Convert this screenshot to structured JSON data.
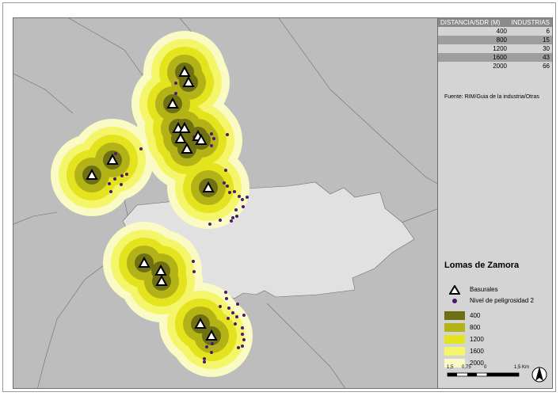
{
  "table": {
    "header_left": "DISTANCIA/SDR (M)",
    "header_right": "INDUSTRIAS",
    "rows": [
      {
        "distance": "400",
        "industries": "6",
        "shade": "#d4d4d4"
      },
      {
        "distance": "800",
        "industries": "15",
        "shade": "#9e9e9e"
      },
      {
        "distance": "1200",
        "industries": "30",
        "shade": "#d4d4d4"
      },
      {
        "distance": "1600",
        "industries": "43",
        "shade": "#9e9e9e"
      },
      {
        "distance": "2000",
        "industries": "66",
        "shade": "#d4d4d4"
      }
    ]
  },
  "source_note": "Fuente: RIM/Guia de la industria/Otras",
  "legend": {
    "title": "Lomas de Zamora",
    "basurales_label": "Basurales",
    "industry_label": "Nivel de peligrosidad 2",
    "buffers": [
      {
        "label": "400",
        "color": "#6f6f14"
      },
      {
        "label": "800",
        "color": "#b3b317"
      },
      {
        "label": "1200",
        "color": "#e3e31e"
      },
      {
        "label": "1600",
        "color": "#f5f56a"
      },
      {
        "label": "2000",
        "color": "#fafac4"
      }
    ]
  },
  "scale": {
    "labels": [
      "1,5",
      "0,75",
      "0",
      "1,5 Km"
    ]
  },
  "colors": {
    "background_land": "#bdbdbd",
    "municipality": "#e1e1e1",
    "industry_point": "#4b1872",
    "boundary": "#6e6e6e"
  },
  "map": {
    "sites": [
      [
        228,
        86
      ],
      [
        233,
        99
      ],
      [
        213,
        126
      ],
      [
        220,
        157
      ],
      [
        228,
        157
      ],
      [
        223,
        170
      ],
      [
        245,
        167
      ],
      [
        249,
        172
      ],
      [
        231,
        183
      ],
      [
        137,
        197
      ],
      [
        111,
        216
      ],
      [
        258,
        232
      ],
      [
        177,
        327
      ],
      [
        198,
        337
      ],
      [
        199,
        350
      ],
      [
        248,
        404
      ],
      [
        262,
        419
      ]
    ],
    "industries": [
      [
        217,
        100
      ],
      [
        217,
        113
      ],
      [
        240,
        168
      ],
      [
        262,
        164
      ],
      [
        265,
        170
      ],
      [
        262,
        179
      ],
      [
        282,
        165
      ],
      [
        141,
        189
      ],
      [
        173,
        183
      ],
      [
        155,
        215
      ],
      [
        149,
        217
      ],
      [
        140,
        221
      ],
      [
        133,
        227
      ],
      [
        135,
        237
      ],
      [
        148,
        228
      ],
      [
        280,
        210
      ],
      [
        278,
        226
      ],
      [
        282,
        230
      ],
      [
        285,
        238
      ],
      [
        291,
        237
      ],
      [
        297,
        243
      ],
      [
        307,
        244
      ],
      [
        301,
        247
      ],
      [
        302,
        256
      ],
      [
        293,
        260
      ],
      [
        294,
        268
      ],
      [
        289,
        270
      ],
      [
        287,
        274
      ],
      [
        273,
        273
      ],
      [
        260,
        278
      ],
      [
        239,
        325
      ],
      [
        240,
        338
      ],
      [
        280,
        364
      ],
      [
        281,
        372
      ],
      [
        273,
        382
      ],
      [
        284,
        384
      ],
      [
        295,
        379
      ],
      [
        289,
        390
      ],
      [
        294,
        395
      ],
      [
        303,
        393
      ],
      [
        283,
        397
      ],
      [
        292,
        404
      ],
      [
        301,
        409
      ],
      [
        301,
        417
      ],
      [
        303,
        424
      ],
      [
        301,
        432
      ],
      [
        296,
        434
      ],
      [
        263,
        429
      ],
      [
        256,
        433
      ],
      [
        262,
        440
      ],
      [
        253,
        448
      ],
      [
        253,
        452
      ]
    ]
  }
}
